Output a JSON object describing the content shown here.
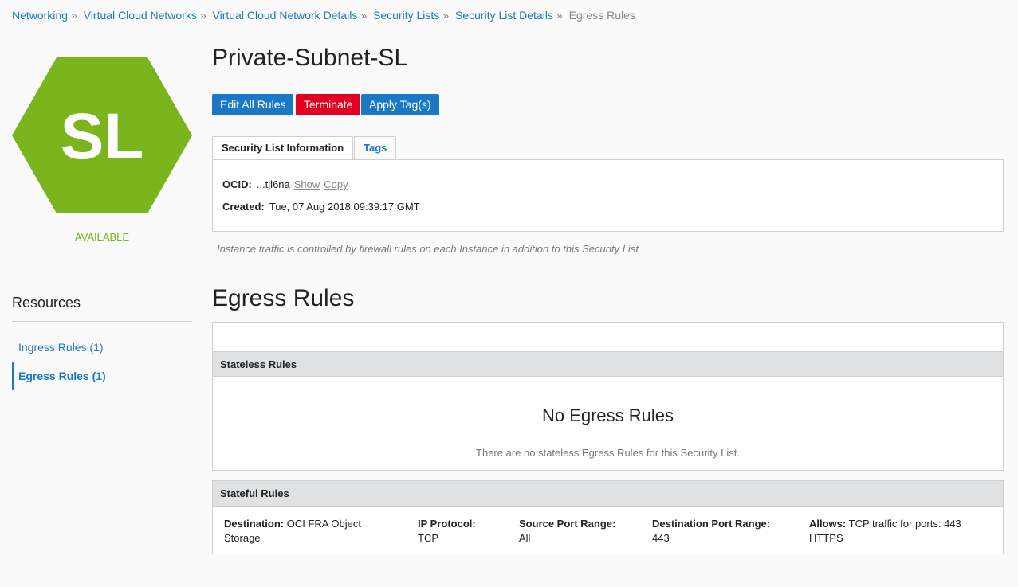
{
  "breadcrumb": {
    "items": [
      "Networking",
      "Virtual Cloud Networks",
      "Virtual Cloud Network Details",
      "Security Lists",
      "Security List Details"
    ],
    "current": "Egress Rules",
    "separator": "»"
  },
  "resource": {
    "badge_text": "SL",
    "badge_color": "#7ab51d",
    "status": "AVAILABLE",
    "title": "Private-Subnet-SL"
  },
  "actions": {
    "edit_label": "Edit All Rules",
    "terminate_label": "Terminate",
    "apply_tags_label": "Apply Tag(s)"
  },
  "tabs": [
    {
      "label": "Security List Information",
      "active": true
    },
    {
      "label": "Tags",
      "active": false
    }
  ],
  "info": {
    "ocid_label": "OCID:",
    "ocid_value": "...tjl6na",
    "show_label": "Show",
    "copy_label": "Copy",
    "created_label": "Created:",
    "created_value": "Tue, 07 Aug 2018 09:39:17 GMT"
  },
  "note": "Instance traffic is controlled by firewall rules on each Instance in addition to this Security List",
  "resources": {
    "title": "Resources",
    "items": [
      {
        "label": "Ingress Rules (1)",
        "active": false
      },
      {
        "label": "Egress Rules (1)",
        "active": true
      }
    ]
  },
  "section": {
    "title": "Egress Rules",
    "stateless": {
      "header": "Stateless Rules",
      "empty_title": "No Egress Rules",
      "empty_sub": "There are no stateless Egress Rules for this Security List."
    },
    "stateful": {
      "header": "Stateful Rules",
      "rule": {
        "destination_label": "Destination:",
        "destination_value": "OCI FRA Object Storage",
        "protocol_label": "IP Protocol:",
        "protocol_value": "TCP",
        "source_port_label": "Source Port Range:",
        "source_port_value": "All",
        "dest_port_label": "Destination Port Range:",
        "dest_port_value": "443",
        "allows_label": "Allows:",
        "allows_value": "TCP traffic for ports: 443 HTTPS"
      }
    }
  },
  "colors": {
    "link": "#1b78c4",
    "danger": "#e20022",
    "status": "#7ab51d"
  }
}
